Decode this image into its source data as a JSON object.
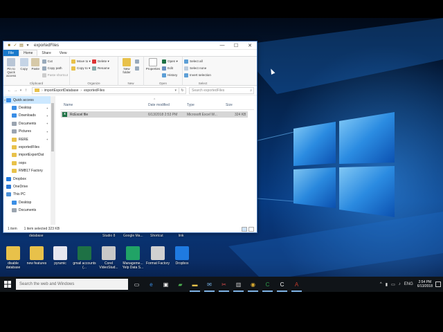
{
  "window": {
    "title": "exportedFiles",
    "controls": {
      "minimize": "—",
      "maximize": "☐",
      "close": "✕"
    },
    "ribbon_tabs": [
      "File",
      "Home",
      "Share",
      "View"
    ],
    "clipboard": {
      "pin_label": "Pin to Quick access",
      "copy_label": "Copy",
      "paste_label": "Paste",
      "cut_label": "Cut",
      "copy_path_label": "Copy path",
      "paste_shortcut_label": "Paste shortcut",
      "group_label": "Clipboard"
    },
    "organize": {
      "move_to_label": "Move to ▾",
      "copy_to_label": "Copy to ▾",
      "delete_label": "Delete ▾",
      "rename_label": "Rename",
      "group_label": "Organize"
    },
    "new": {
      "new_folder_label": "New folder",
      "group_label": "New"
    },
    "open": {
      "properties_label": "Properties",
      "open_label": "Open ▾",
      "edit_label": "Edit",
      "history_label": "History",
      "group_label": "Open"
    },
    "select": {
      "select_all_label": "Select all",
      "select_none_label": "Select none",
      "invert_label": "Invert selection",
      "group_label": "Select"
    },
    "address": {
      "back": "←",
      "forward": "→",
      "up": "↑",
      "path": [
        "importExportDatabase",
        "exportedFiles"
      ],
      "separator": "›",
      "search_placeholder": "Search exportedFiles"
    },
    "nav_pane": [
      {
        "label": "Quick access",
        "icon": "star-icon",
        "color": "#3a8ee6",
        "selected": true,
        "pinned": false
      },
      {
        "label": "Desktop",
        "icon": "desktop-icon",
        "color": "#3a8ee6",
        "selected": false,
        "pinned": true
      },
      {
        "label": "Downloads",
        "icon": "download-icon",
        "color": "#3a8ee6",
        "selected": false,
        "pinned": true
      },
      {
        "label": "Documents",
        "icon": "documents-icon",
        "color": "#9aa4b0",
        "selected": false,
        "pinned": true
      },
      {
        "label": "Pictures",
        "icon": "pictures-icon",
        "color": "#9aa4b0",
        "selected": false,
        "pinned": true
      },
      {
        "label": "RERE",
        "icon": "folder-icon",
        "color": "#e8c14a",
        "selected": false,
        "pinned": true
      },
      {
        "label": "exportedFiles",
        "icon": "folder-icon",
        "color": "#e8c14a",
        "selected": false,
        "pinned": false
      },
      {
        "label": "importExportDat",
        "icon": "folder-icon",
        "color": "#e8c14a",
        "selected": false,
        "pinned": false
      },
      {
        "label": "oops",
        "icon": "folder-icon",
        "color": "#e8c14a",
        "selected": false,
        "pinned": false
      },
      {
        "label": "RMB17 Factory",
        "icon": "folder-icon",
        "color": "#e8c14a",
        "selected": false,
        "pinned": false
      },
      {
        "label": "Dropbox",
        "icon": "dropbox-icon",
        "color": "#1f7ae0",
        "selected": false,
        "pinned": false
      },
      {
        "label": "OneDrive",
        "icon": "onedrive-icon",
        "color": "#2a78d6",
        "selected": false,
        "pinned": false
      },
      {
        "label": "This PC",
        "icon": "pc-icon",
        "color": "#4a90d9",
        "selected": false,
        "pinned": false
      },
      {
        "label": "Desktop",
        "icon": "desktop-icon",
        "color": "#3a8ee6",
        "selected": false,
        "pinned": false
      },
      {
        "label": "Documents",
        "icon": "documents-icon",
        "color": "#9aa4b0",
        "selected": false,
        "pinned": false
      }
    ],
    "columns": {
      "name": "Name",
      "date": "Date modified",
      "type": "Type",
      "size": "Size"
    },
    "sort_arrow": "^",
    "files": [
      {
        "name": "RcExcel file",
        "date": "6/13/2018 2:53 PM",
        "type": "Microsoft Excel W...",
        "size": "324 KB",
        "icon": "excel-icon",
        "icon_letter": "x"
      }
    ],
    "status": {
      "count": "1 item",
      "selection": "1 item selected  323 KB"
    }
  },
  "desktop": {
    "partial_labels": [
      "database",
      "Studio 8",
      "Google Ma...",
      "Shortcut",
      "link"
    ],
    "icons": [
      {
        "label": "disable database",
        "icon": "folder-icon",
        "color": "#e8c14a"
      },
      {
        "label": "new features",
        "icon": "folder-icon",
        "color": "#e8c14a"
      },
      {
        "label": "pyramic",
        "icon": "file-icon",
        "color": "#e6e6f0"
      },
      {
        "label": "gmail accounts (...",
        "icon": "excel-icon",
        "color": "#1e7145"
      },
      {
        "label": "Corel VideoStud...",
        "icon": "corel-icon",
        "color": "#c8c8c8"
      },
      {
        "label": "Manageme... Yelp Data S...",
        "icon": "excel-icon",
        "color": "#21a366"
      },
      {
        "label": "Format Factory",
        "icon": "format-factory-icon",
        "color": "#d0d0d0"
      },
      {
        "label": "Dropbox",
        "icon": "dropbox-icon",
        "color": "#1f7ae0"
      }
    ]
  },
  "taskbar": {
    "search_placeholder": "Search the web and Windows",
    "apps": [
      {
        "name": "task-view-icon",
        "glyph": "▭",
        "color": "#ffffff"
      },
      {
        "name": "edge-icon",
        "glyph": "e",
        "color": "#3a8ee6"
      },
      {
        "name": "store-icon",
        "glyph": "▣",
        "color": "#ffffff"
      },
      {
        "name": "app-green-icon",
        "glyph": "▰",
        "color": "#4caf50"
      },
      {
        "name": "file-explorer-icon",
        "glyph": "▬",
        "color": "#e8c14a"
      },
      {
        "name": "mail-icon",
        "glyph": "✉",
        "color": "#79b3e8"
      },
      {
        "name": "snipping-icon",
        "glyph": "✂",
        "color": "#e05050"
      },
      {
        "name": "film-icon",
        "glyph": "▥",
        "color": "#cccccc"
      },
      {
        "name": "chrome-icon",
        "glyph": "◉",
        "color": "#e0b030"
      },
      {
        "name": "camtasia-icon",
        "glyph": "C",
        "color": "#2e9e4a"
      },
      {
        "name": "word-c-icon",
        "glyph": "C",
        "color": "#ffffff"
      },
      {
        "name": "access-icon",
        "glyph": "A",
        "color": "#c0392b"
      }
    ],
    "tray": {
      "chevron": "^",
      "language": "ENG",
      "time": "2:54 PM",
      "date": "6/13/2018"
    }
  }
}
